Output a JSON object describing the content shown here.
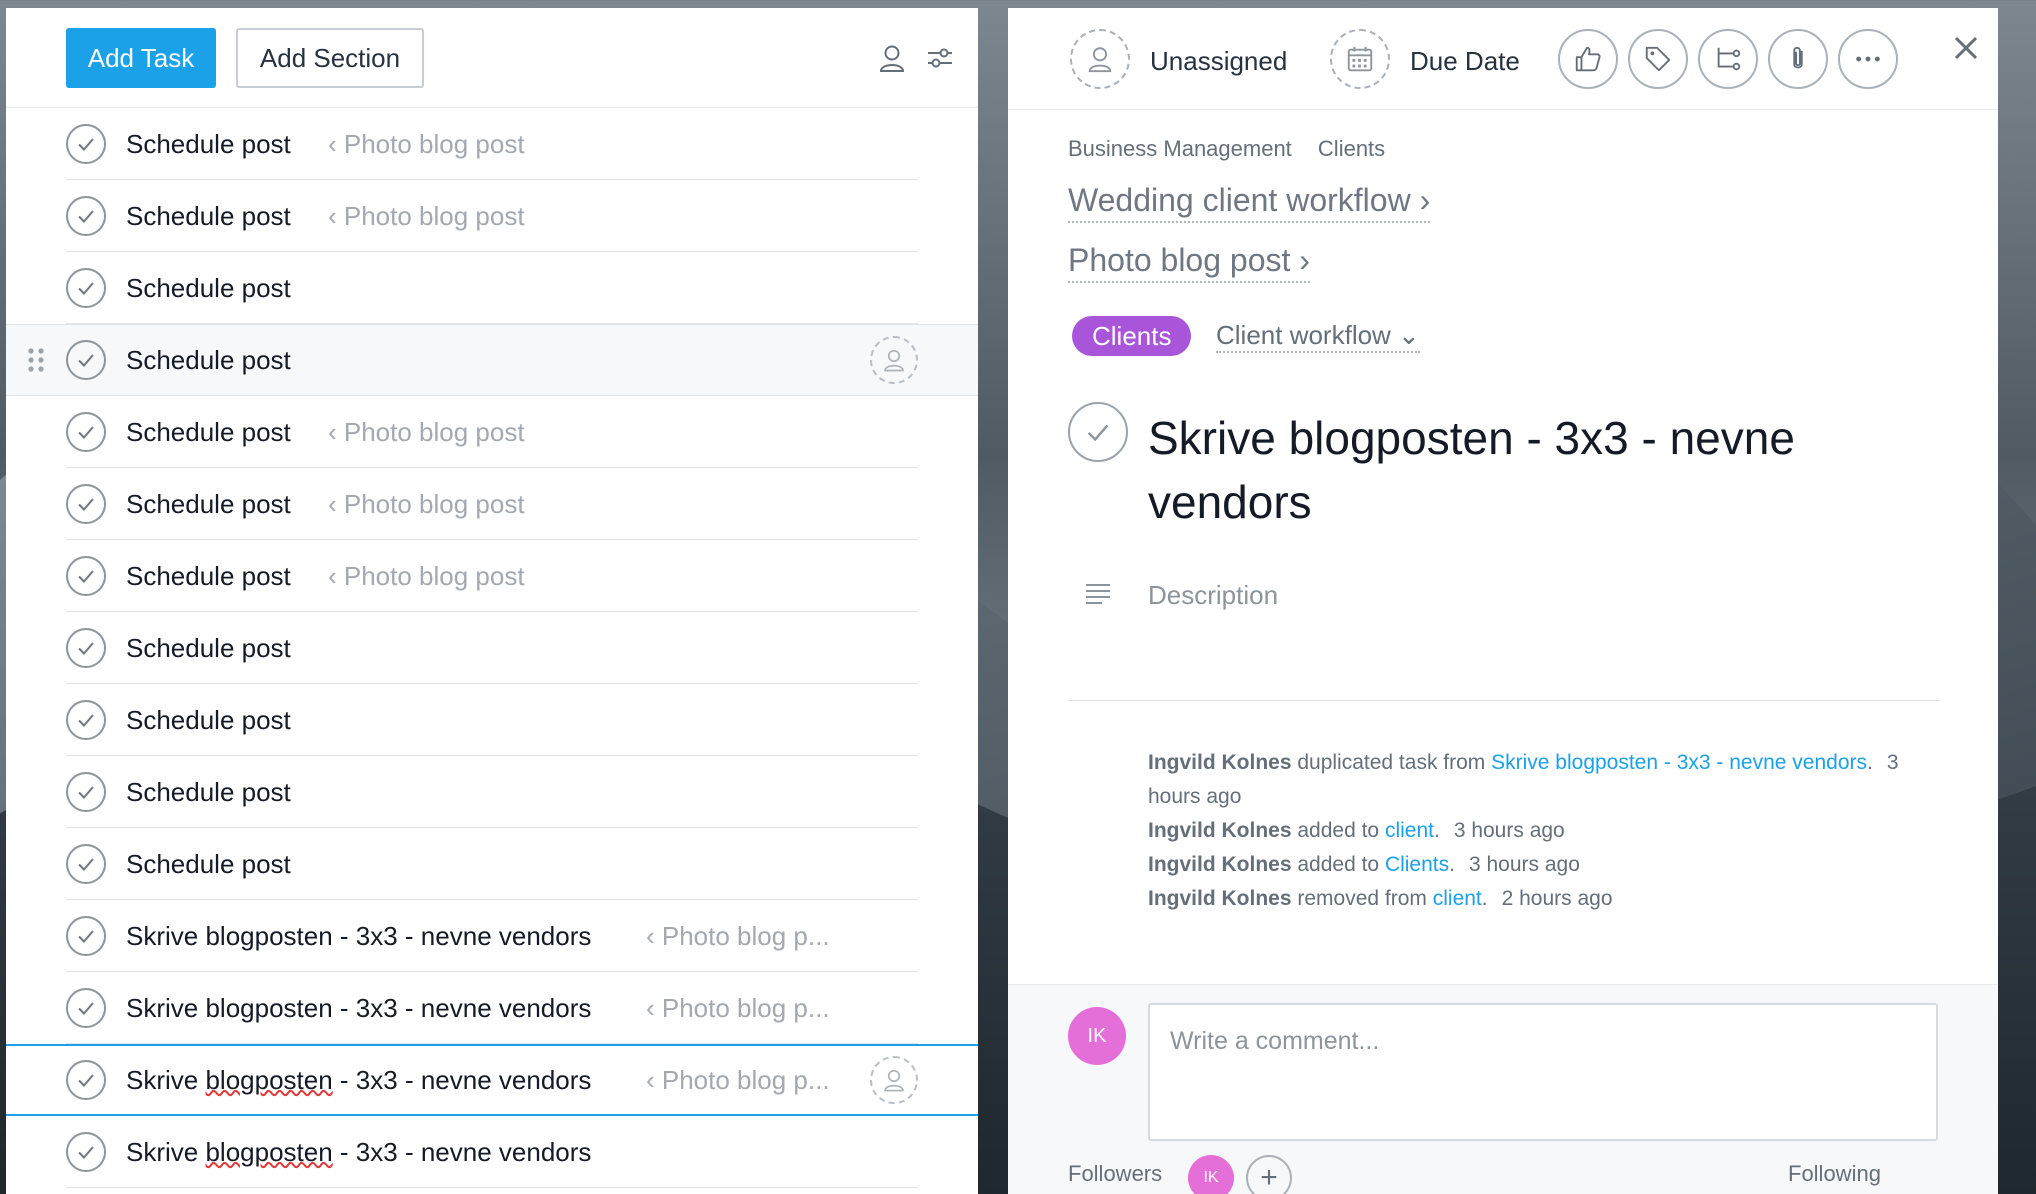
{
  "toolbar": {
    "add_task_label": "Add Task",
    "add_section_label": "Add Section"
  },
  "tasks": [
    {
      "name": "Schedule post",
      "parent": "‹ Photo blog post"
    },
    {
      "name": "Schedule post",
      "parent": "‹ Photo blog post"
    },
    {
      "name": "Schedule post",
      "parent": ""
    },
    {
      "name": "Schedule post",
      "parent": "",
      "state": "hover"
    },
    {
      "name": "Schedule post",
      "parent": "‹ Photo blog post"
    },
    {
      "name": "Schedule post",
      "parent": "‹ Photo blog post"
    },
    {
      "name": "Schedule post",
      "parent": "‹ Photo blog post"
    },
    {
      "name": "Schedule post",
      "parent": ""
    },
    {
      "name": "Schedule post",
      "parent": ""
    },
    {
      "name": "Schedule post",
      "parent": ""
    },
    {
      "name": "Schedule post",
      "parent": ""
    },
    {
      "name": "Skrive blogposten - 3x3 - nevne vendors",
      "parent": "‹ Photo blog p..."
    },
    {
      "name": "Skrive blogposten - 3x3 - nevne vendors",
      "parent": "‹ Photo blog p..."
    },
    {
      "name": "Skrive blogposten - 3x3 - nevne vendors",
      "parent": "‹ Photo blog p...",
      "state": "selected"
    },
    {
      "name": "Skrive blogposten - 3x3 - nevne vendors",
      "parent": ""
    }
  ],
  "detail": {
    "assignee_label": "Unassigned",
    "due_date_label": "Due Date",
    "breadcrumb": [
      "Business Management",
      "Clients"
    ],
    "parent_links": [
      "Wedding client workflow ›",
      "Photo blog post ›"
    ],
    "project_pill": "Clients",
    "section_label": "Client workflow ⌄",
    "title": "Skrive blogposten - 3x3 - nevne vendors",
    "description_placeholder": "Description",
    "activity": [
      {
        "who": "Ingvild Kolnes",
        "action": " duplicated task from ",
        "link": "Skrive blogposten - 3x3 - nevne vendors",
        "time": "3 hours ago"
      },
      {
        "who": "Ingvild Kolnes",
        "action": " added to ",
        "link": "client",
        "time": "3 hours ago"
      },
      {
        "who": "Ingvild Kolnes",
        "action": " added to ",
        "link": "Clients",
        "time": "3 hours ago"
      },
      {
        "who": "Ingvild Kolnes",
        "action": " removed from ",
        "link": "client",
        "time": "2 hours ago"
      }
    ],
    "comment_avatar_initials": "IK",
    "comment_placeholder": "Write a comment...",
    "followers_label": "Followers",
    "follower_initials": "IK",
    "following_label": "Following"
  },
  "colors": {
    "accent_blue": "#1aa1e8",
    "pill_purple": "#a855d9",
    "avatar_pink": "#e46fd8"
  }
}
